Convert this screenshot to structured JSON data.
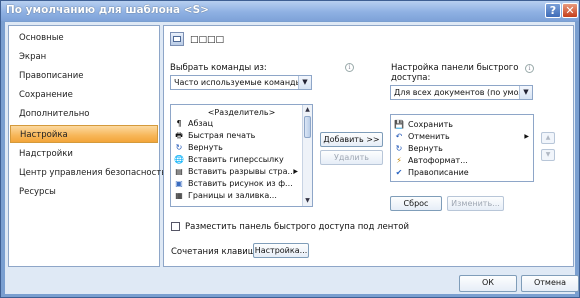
{
  "window": {
    "title": "По умолчанию для шаблона <S>",
    "help_label": "?",
    "close_label": "✕"
  },
  "nav": {
    "items": [
      {
        "label": "Основные"
      },
      {
        "label": "Экран"
      },
      {
        "label": "Правописание"
      },
      {
        "label": "Сохранение"
      },
      {
        "label": "Дополнительно"
      },
      {
        "label": "Настройка",
        "selected": true
      },
      {
        "label": "Надстройки"
      },
      {
        "label": "Центр управления безопасностью"
      },
      {
        "label": "Ресурсы"
      }
    ]
  },
  "panel": {
    "header_title": "□□□□",
    "choose_label": "Выбрать команды из:",
    "choose_value": "Часто используемые команды",
    "qat_label_line1": "Настройка панели быстрого",
    "qat_label_line2": "доступа:",
    "qat_value": "Для всех документов (по умолча...",
    "info_glyph": "i",
    "commands": [
      {
        "label": "<Разделитель>",
        "separator": true
      },
      {
        "label": "Абзац",
        "icon": "paragraph-icon",
        "glyph": "¶"
      },
      {
        "label": "Быстрая печать",
        "icon": "printer-icon",
        "glyph": "🖶"
      },
      {
        "label": "Вернуть",
        "icon": "redo-icon",
        "glyph": "↻"
      },
      {
        "label": "Вставить гиперссылку",
        "icon": "hyperlink-icon",
        "glyph": "🌐"
      },
      {
        "label": "Вставить разрывы стра...",
        "icon": "page-break-icon",
        "glyph": "▤",
        "submenu": true
      },
      {
        "label": "Вставить рисунок из ф...",
        "icon": "picture-icon",
        "glyph": "▣"
      },
      {
        "label": "Границы и заливка...",
        "icon": "borders-icon",
        "glyph": "▦"
      }
    ],
    "add_button": "Добавить >>",
    "remove_button": "Удалить",
    "qat_items": [
      {
        "label": "Сохранить",
        "icon": "save-icon",
        "glyph": "💾"
      },
      {
        "label": "Отменить",
        "icon": "undo-icon",
        "glyph": "↶",
        "submenu": true
      },
      {
        "label": "Вернуть",
        "icon": "redo-icon",
        "glyph": "↻"
      },
      {
        "label": "Автоформат...",
        "icon": "autoformat-icon",
        "glyph": "⚡"
      },
      {
        "label": "Правописание",
        "icon": "spelling-icon",
        "glyph": "✔"
      }
    ],
    "reset_button": "Сброс",
    "modify_button": "Изменить...",
    "move_up_glyph": "▲",
    "move_down_glyph": "▼",
    "below_ribbon_label": "Разместить панель быстрого доступа под лентой",
    "below_ribbon_checked": false,
    "shortcuts_label": "Сочетания клавиш:",
    "customize_button": "Настройка..."
  },
  "footer": {
    "ok_label": "ОК",
    "cancel_label": "Отмена"
  }
}
